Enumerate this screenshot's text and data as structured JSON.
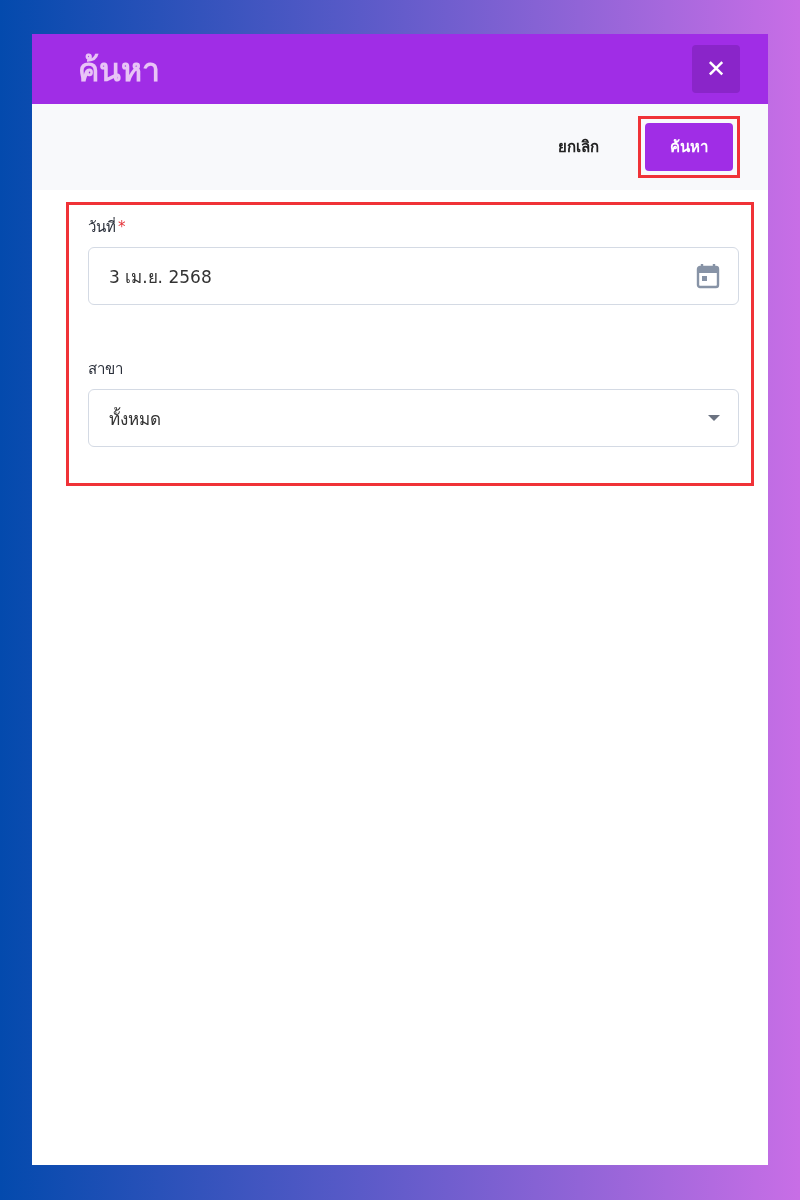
{
  "dialog": {
    "title": "ค้นหา",
    "close": "✕"
  },
  "actions": {
    "cancel": {
      "label": "ยกเลิก",
      "highlighted": false
    },
    "search": {
      "label": "ค้นหา",
      "highlighted": true
    }
  },
  "form": {
    "highlighted": true,
    "fields": [
      {
        "kind": "date",
        "label": "วันที่",
        "required_mark": "*",
        "value": "3 เม.ย. 2568"
      },
      {
        "kind": "select",
        "label": "สาขา",
        "value": "ทั้งหมด"
      }
    ]
  }
}
